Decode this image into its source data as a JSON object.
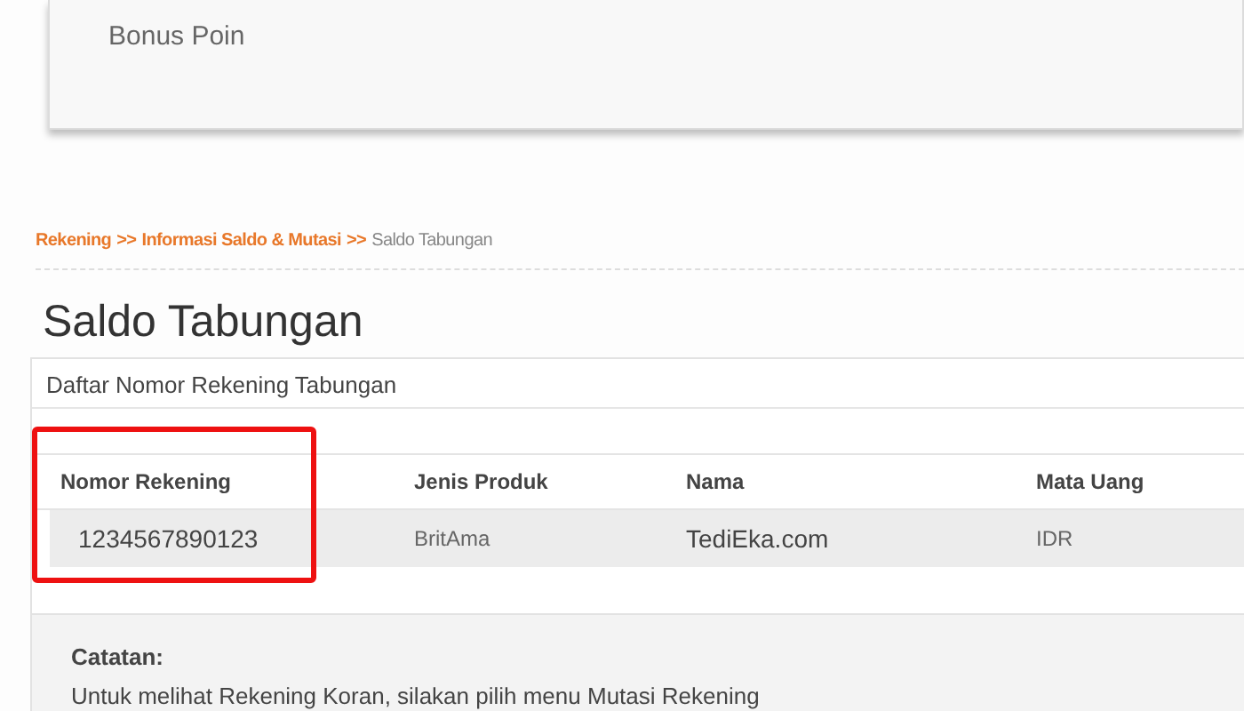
{
  "bonus_card": {
    "label": "Bonus Poin"
  },
  "breadcrumb": [
    {
      "kind": "link",
      "text": "Rekening"
    },
    {
      "kind": "separator",
      "text": ">>"
    },
    {
      "kind": "link",
      "text": "Informasi Saldo & Mutasi"
    },
    {
      "kind": "separator",
      "text": ">>"
    },
    {
      "kind": "current",
      "text": "Saldo Tabungan"
    }
  ],
  "page_title": "Saldo Tabungan",
  "panel": {
    "title": "Daftar Nomor Rekening Tabungan",
    "table": {
      "columns": [
        "Nomor Rekening",
        "Jenis Produk",
        "Nama",
        "Mata Uang"
      ],
      "rows": [
        [
          "1234567890123",
          "BritAma",
          "TediEka.com",
          "IDR"
        ]
      ]
    },
    "note": {
      "heading": "Catatan:",
      "text": "Untuk melihat Rekening Koran, silakan pilih menu Mutasi Rekening"
    }
  }
}
